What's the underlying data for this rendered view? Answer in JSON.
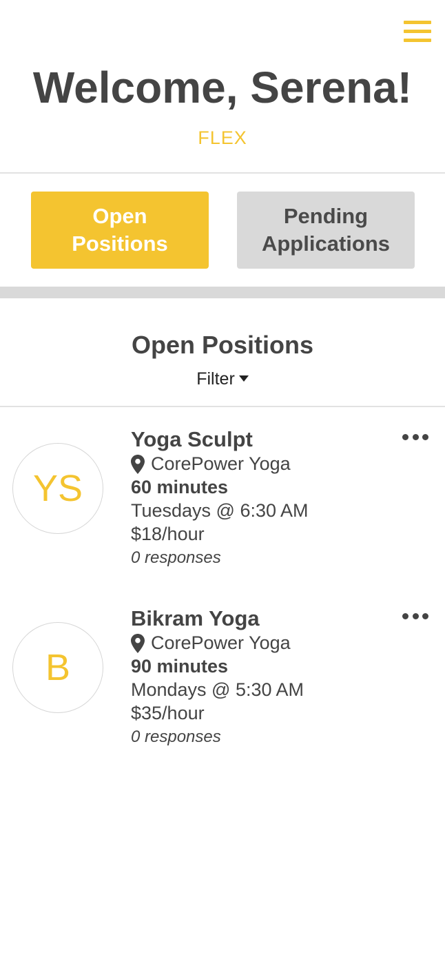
{
  "header": {
    "menu_icon": "hamburger-menu-icon",
    "welcome": "Welcome, Serena!",
    "brand": "FLEX"
  },
  "tabs": [
    {
      "label_line1": "Open",
      "label_line2": "Positions",
      "active": true
    },
    {
      "label_line1": "Pending",
      "label_line2": "Applications",
      "active": false
    }
  ],
  "section": {
    "title": "Open Positions",
    "filter_label": "Filter"
  },
  "positions": [
    {
      "initials": "YS",
      "title": "Yoga Sculpt",
      "location": "CorePower Yoga",
      "duration": "60 minutes",
      "schedule": "Tuesdays @ 6:30 AM",
      "rate": "$18/hour",
      "responses": "0 responses"
    },
    {
      "initials": "B",
      "title": "Bikram Yoga",
      "location": "CorePower Yoga",
      "duration": "90 minutes",
      "schedule": "Mondays @ 5:30 AM",
      "rate": "$35/hour",
      "responses": "0 responses"
    }
  ],
  "colors": {
    "accent": "#f4c430",
    "text": "#444444",
    "inactive_tab": "#d9d9d9"
  }
}
